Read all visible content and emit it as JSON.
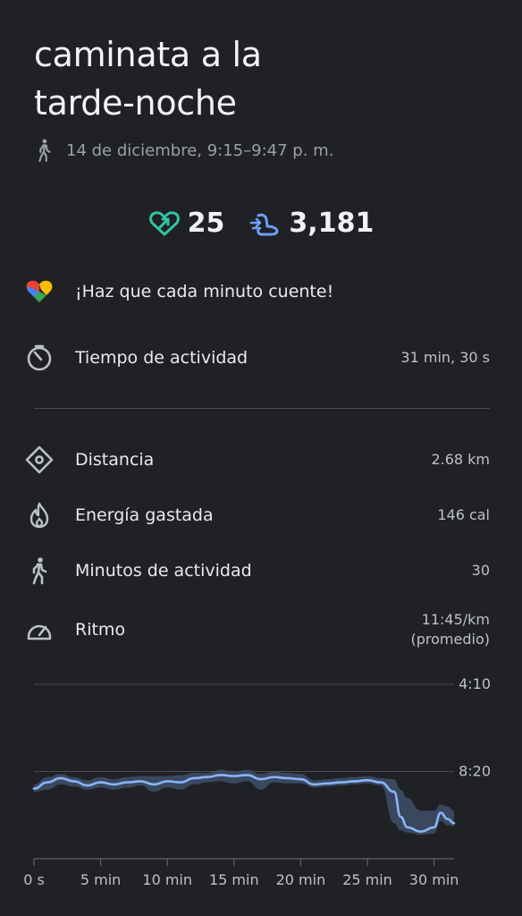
{
  "activity": {
    "title_line1": "caminata a la",
    "title_line2": "tarde-noche",
    "date_time": "14 de diciembre, 9:15–9:47 p. m."
  },
  "stats": {
    "heart_points": "25",
    "steps": "3,181",
    "heart_color": "#2fc6a4",
    "steps_color": "#6aa0f8"
  },
  "motto": "¡Haz que cada minuto cuente!",
  "metrics": {
    "active_time": {
      "label": "Tiempo de actividad",
      "value": "31 min, 30 s",
      "icon": "timer-icon"
    },
    "distance": {
      "label": "Distancia",
      "value": "2.68 km",
      "icon": "location-pin-icon"
    },
    "energy": {
      "label": "Energía gastada",
      "value": "146 cal",
      "icon": "flame-icon"
    },
    "move_minutes": {
      "label": "Minutos de actividad",
      "value": "30",
      "icon": "walking-icon"
    },
    "pace": {
      "label": "Ritmo",
      "value": "11:45/km",
      "value_note": "(promedio)",
      "icon": "speedometer-icon"
    }
  },
  "chart_data": {
    "type": "line",
    "title": "",
    "xlabel": "",
    "ylabel": "",
    "x_tick_labels": [
      "0 s",
      "5 min",
      "10 min",
      "15 min",
      "20 min",
      "25 min",
      "30 min"
    ],
    "x_ticks_min": [
      0,
      5,
      10,
      15,
      20,
      25,
      30
    ],
    "y_tick_labels": [
      "4:10",
      "8:20"
    ],
    "y_ticks_min_per_km": [
      4.1667,
      8.3333
    ],
    "y_inverted": true,
    "xlim": [
      0,
      31.5
    ],
    "ylim_min_per_km": [
      4.1667,
      12.5
    ],
    "grid": true,
    "line_color": "#8ab4f8",
    "band_color": "#3c4d66",
    "series": [
      {
        "x": [
          0,
          1,
          2,
          3,
          4,
          5,
          6,
          7,
          8,
          9,
          10,
          11,
          12,
          13,
          14,
          15,
          16,
          17,
          18,
          19,
          20,
          21,
          22,
          23,
          24,
          25,
          26,
          27,
          27.5,
          28,
          29,
          30,
          30.5,
          31,
          31.5
        ],
        "y": [
          9.15,
          8.85,
          8.65,
          8.8,
          9.0,
          8.85,
          8.95,
          8.85,
          8.8,
          8.95,
          8.8,
          8.85,
          8.65,
          8.6,
          8.5,
          8.55,
          8.5,
          8.7,
          8.6,
          8.65,
          8.7,
          8.95,
          8.9,
          8.85,
          8.8,
          8.75,
          8.85,
          9.3,
          10.5,
          11.0,
          11.2,
          11.0,
          10.3,
          10.6,
          10.8
        ],
        "band_low": [
          9.3,
          9.2,
          8.95,
          9.05,
          9.2,
          9.1,
          9.2,
          9.1,
          9.0,
          9.3,
          9.1,
          9.2,
          8.95,
          8.85,
          8.8,
          8.9,
          8.8,
          9.2,
          8.85,
          8.9,
          8.9,
          9.1,
          9.05,
          9.0,
          8.95,
          8.9,
          9.0,
          10.8,
          11.15,
          11.25,
          11.35,
          11.3,
          10.7,
          10.9,
          10.95
        ],
        "band_high": [
          8.95,
          8.6,
          8.45,
          8.6,
          8.75,
          8.6,
          8.7,
          8.6,
          8.55,
          8.55,
          8.55,
          8.5,
          8.4,
          8.4,
          8.25,
          8.35,
          8.25,
          8.45,
          8.35,
          8.4,
          8.45,
          8.75,
          8.7,
          8.65,
          8.6,
          8.55,
          8.65,
          8.7,
          9.2,
          9.6,
          10.2,
          10.2,
          9.9,
          10.0,
          10.2
        ]
      }
    ]
  }
}
